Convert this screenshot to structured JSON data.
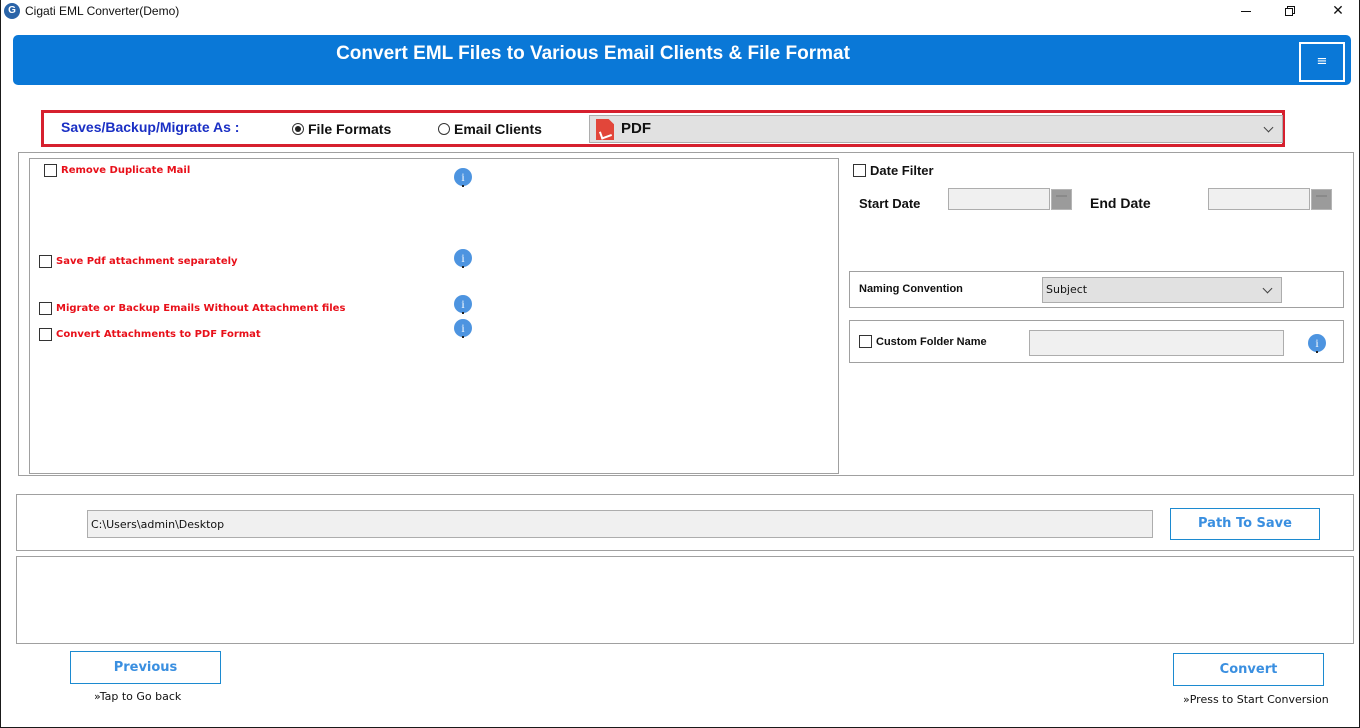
{
  "window": {
    "title": "Cigati EML Converter(Demo)",
    "app_icon_glyph": "G",
    "controls": {
      "minimize": "minimize-icon",
      "maximize": "restore-icon",
      "close": "close-icon"
    },
    "close_glyph": "✕"
  },
  "header": {
    "title": "Convert EML Files to Various Email Clients & File Format",
    "menu_glyph": "≡"
  },
  "save_as": {
    "label": "Saves/Backup/Migrate As :",
    "options": [
      {
        "label": "File Formats",
        "selected": true
      },
      {
        "label": "Email Clients",
        "selected": false
      }
    ],
    "format_select": {
      "value": "PDF",
      "icon": "pdf-icon"
    },
    "accent_color": "#d6202e"
  },
  "options": {
    "checkboxes": [
      {
        "label": "Remove Duplicate Mail",
        "checked": false
      },
      {
        "label": "Save Pdf attachment separately",
        "checked": false
      },
      {
        "label": "Migrate or Backup Emails Without Attachment files",
        "checked": false
      },
      {
        "label": "Convert Attachments to PDF Format",
        "checked": false
      }
    ],
    "info_glyph": "i"
  },
  "date_filter": {
    "label": "Date Filter",
    "checked": false,
    "start_label": "Start Date",
    "start_value": "",
    "end_label": "End Date",
    "end_value": ""
  },
  "naming": {
    "label": "Naming Convention",
    "value": "Subject"
  },
  "custom_folder": {
    "label": "Custom Folder Name",
    "checked": false,
    "value": ""
  },
  "path": {
    "value": "C:\\Users\\admin\\Desktop",
    "button": "Path To Save"
  },
  "footer": {
    "previous": "Previous",
    "previous_hint": "»Tap to Go back",
    "convert": "Convert",
    "convert_hint": "»Press to Start Conversion"
  },
  "colors": {
    "brand_blue": "#0a78d7",
    "option_red": "#e8101a",
    "label_blue": "#1a2fc4",
    "button_text": "#3a8fe0"
  }
}
